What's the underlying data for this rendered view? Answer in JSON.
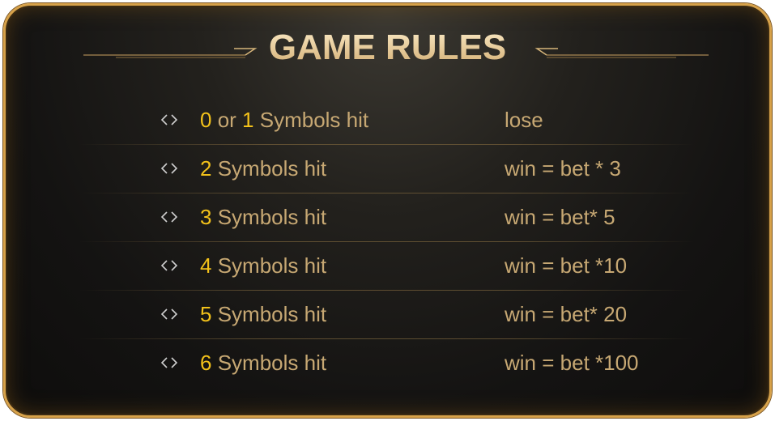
{
  "title": "GAME RULES",
  "colors": {
    "accent_gold": "#f3c21a",
    "text_tan": "#c7a873",
    "border_gold": "#d7a24a",
    "background": "#141312"
  },
  "rules": [
    {
      "number": "0",
      "joiner": " or ",
      "number2": "1",
      "text": " Symbols hit",
      "result": "lose"
    },
    {
      "number": "2",
      "text": " Symbols hit",
      "result": "win = bet * 3"
    },
    {
      "number": "3",
      "text": " Symbols hit",
      "result": "win = bet* 5"
    },
    {
      "number": "4",
      "text": " Symbols hit",
      "result": "win = bet *10"
    },
    {
      "number": "5",
      "text": " Symbols hit",
      "result": "win = bet* 20"
    },
    {
      "number": "6",
      "text": " Symbols hit",
      "result": "win = bet *100"
    }
  ]
}
